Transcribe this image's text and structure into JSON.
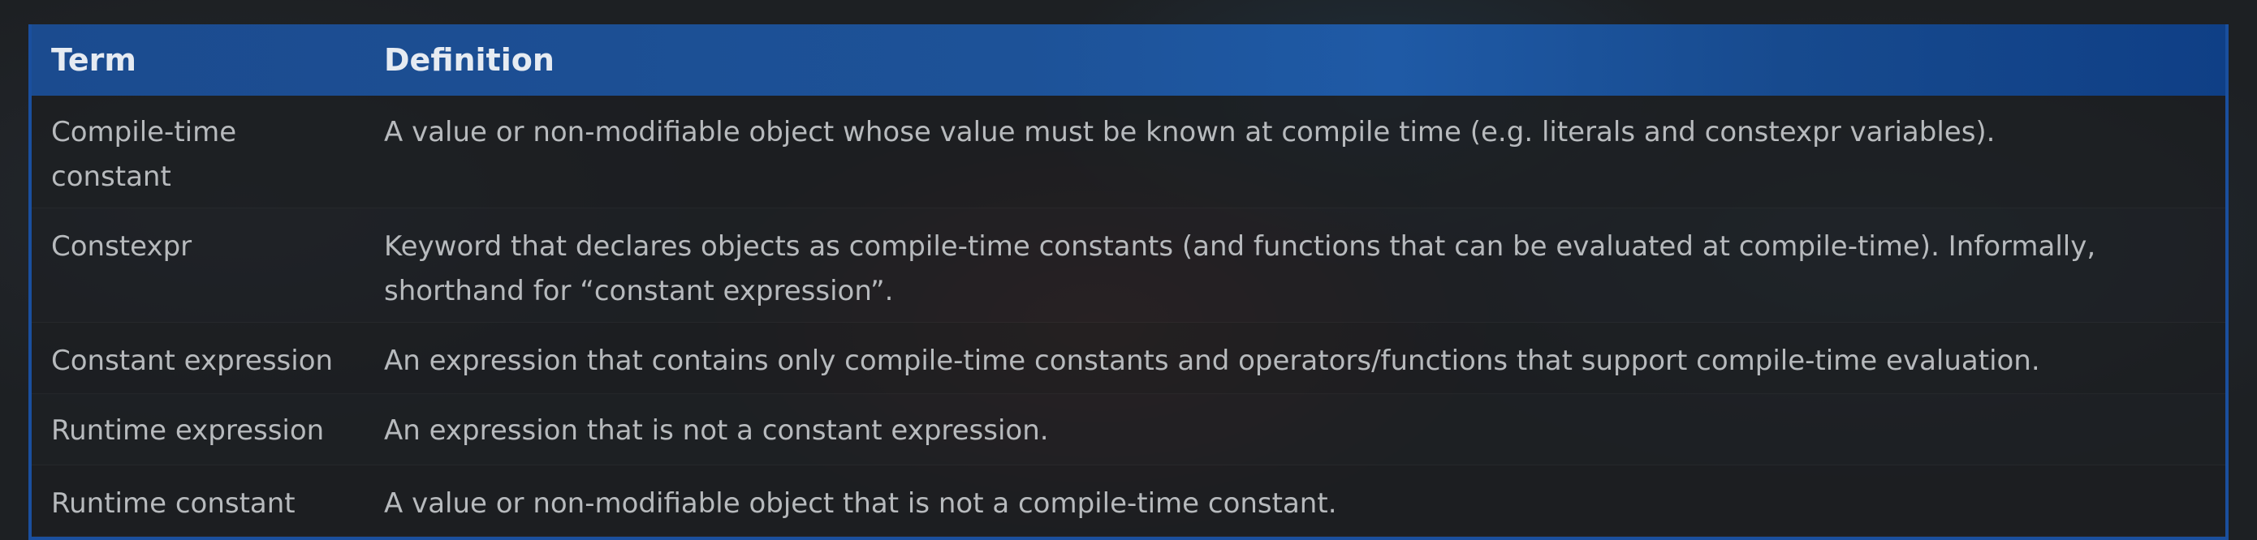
{
  "table": {
    "headers": {
      "term": "Term",
      "definition": "Definition"
    },
    "rows": [
      {
        "term": "Compile-time constant",
        "definition": "A value or non-modifiable object whose value must be known at compile time (e.g. literals and constexpr variables)."
      },
      {
        "term": "Constexpr",
        "definition": "Keyword that declares objects as compile-time constants (and functions that can be evaluated at compile-time). Informally, shorthand for “constant expression”."
      },
      {
        "term": "Constant expression",
        "definition": "An expression that contains only compile-time constants and operators/functions that support compile-time evaluation."
      },
      {
        "term": "Runtime expression",
        "definition": "An expression that is not a constant expression."
      },
      {
        "term": "Runtime constant",
        "definition": "A value or non-modifiable object that is not a compile-time constant."
      }
    ]
  },
  "colors": {
    "header_blue": "#1d5298",
    "border_blue": "#1a4f9e",
    "text": "#b7babd",
    "header_text": "#e6ebf2"
  }
}
